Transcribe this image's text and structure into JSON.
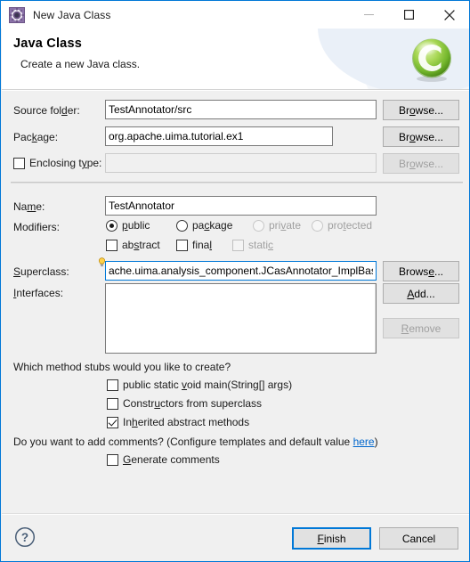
{
  "window": {
    "title": "New Java Class",
    "icon": "java-class-wizard-icon",
    "controls": {
      "minimize": "–",
      "maximize": "☐",
      "close": "✕"
    }
  },
  "banner": {
    "title": "Java Class",
    "subtitle": "Create a new Java class.",
    "icon": "green-c-badge-icon"
  },
  "form": {
    "source_folder": {
      "label": "Source folder:",
      "label_mnemonic": "d",
      "value": "TestAnnotator/src",
      "browse_label": "Browse...",
      "browse_mnemonic": "o"
    },
    "package": {
      "label": "Package:",
      "label_mnemonic": "k",
      "value": "org.apache.uima.tutorial.ex1",
      "browse_label": "Browse...",
      "browse_mnemonic": "w"
    },
    "enclosing_type": {
      "label": "Enclosing type:",
      "label_mnemonic": "y",
      "checked": false,
      "enabled": false,
      "value": "",
      "browse_label": "Browse...",
      "browse_mnemonic": "w"
    },
    "name": {
      "label": "Name:",
      "label_mnemonic": "m",
      "value": "TestAnnotator"
    },
    "modifiers": {
      "label": "Modifiers:",
      "radios": [
        {
          "label": "public",
          "mnemonic": "p",
          "checked": true,
          "enabled": true
        },
        {
          "label": "package",
          "mnemonic": "c",
          "checked": false,
          "enabled": true
        },
        {
          "label": "private",
          "mnemonic": "v",
          "checked": false,
          "enabled": false
        },
        {
          "label": "protected",
          "mnemonic": "t",
          "checked": false,
          "enabled": false
        }
      ],
      "checkboxes": [
        {
          "label": "abstract",
          "mnemonic": "s",
          "checked": false,
          "enabled": true
        },
        {
          "label": "final",
          "mnemonic": "l",
          "checked": false,
          "enabled": true
        },
        {
          "label": "static",
          "mnemonic": "c",
          "checked": false,
          "enabled": false
        }
      ]
    },
    "superclass": {
      "label": "Superclass:",
      "label_mnemonic": "S",
      "value": "ache.uima.analysis_component.JCasAnnotator_ImplBase",
      "focused": true,
      "marker_icon": "lightbulb-hint-icon",
      "browse_label": "Browse...",
      "browse_mnemonic": "e"
    },
    "interfaces": {
      "label": "Interfaces:",
      "label_mnemonic": "I",
      "items": [],
      "add_label": "Add...",
      "add_mnemonic": "A",
      "remove_label": "Remove",
      "remove_mnemonic": "R",
      "remove_enabled": false
    },
    "method_stubs": {
      "question": "Which method stubs would you like to create?",
      "options": [
        {
          "label": "public static void main(String[] args)",
          "mnemonic": "v",
          "checked": false
        },
        {
          "label": "Constructors from superclass",
          "mnemonic": "u",
          "checked": false
        },
        {
          "label": "Inherited abstract methods",
          "mnemonic": "h",
          "checked": true
        }
      ]
    },
    "comments": {
      "question_prefix": "Do you want to add comments? (Configure templates and default value ",
      "link_text": "here",
      "question_suffix": ")",
      "option": {
        "label": "Generate comments",
        "mnemonic": "G",
        "checked": false
      }
    }
  },
  "footer": {
    "help_icon": "help-question-icon",
    "finish_label": "Finish",
    "finish_mnemonic": "F",
    "cancel_label": "Cancel"
  },
  "colors": {
    "window_border": "#0078d7",
    "dialog_bg": "#f0f0f0",
    "focus_border": "#0078d7",
    "link": "#0066cc",
    "badge_green": "#8cc63f"
  }
}
